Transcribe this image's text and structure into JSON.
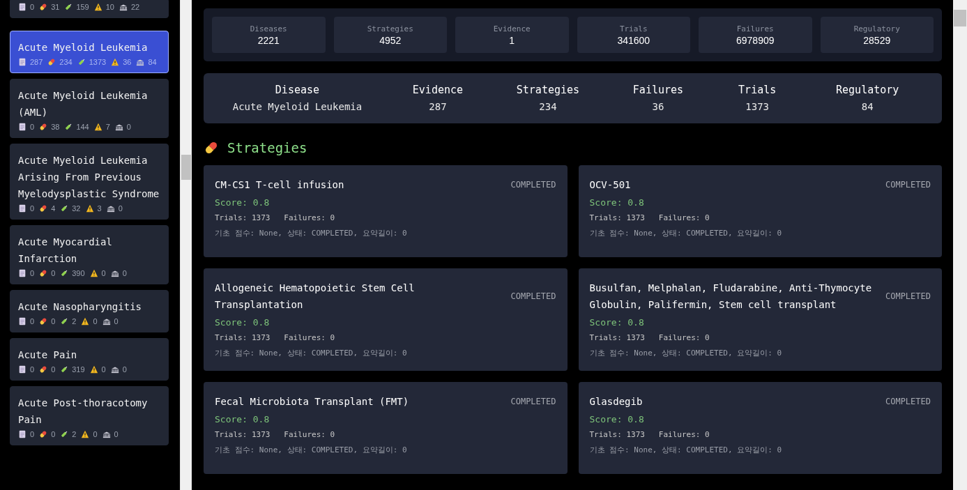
{
  "sidebar": {
    "items": [
      {
        "selected": false,
        "stats": [
          {
            "kind": "evidence",
            "value": "0"
          },
          {
            "kind": "strategy",
            "value": "31"
          },
          {
            "kind": "trial",
            "value": "159"
          },
          {
            "kind": "failure",
            "value": "10"
          },
          {
            "kind": "regulatory",
            "value": "22"
          }
        ]
      },
      {
        "name": "Acute Myeloid Leukemia",
        "selected": true,
        "stats": [
          {
            "kind": "evidence",
            "value": "287"
          },
          {
            "kind": "strategy",
            "value": "234"
          },
          {
            "kind": "trial",
            "value": "1373"
          },
          {
            "kind": "failure",
            "value": "36"
          },
          {
            "kind": "regulatory",
            "value": "84"
          }
        ]
      },
      {
        "name": "Acute Myeloid Leukemia (AML)",
        "selected": false,
        "stats": [
          {
            "kind": "evidence",
            "value": "0"
          },
          {
            "kind": "strategy",
            "value": "38"
          },
          {
            "kind": "trial",
            "value": "144"
          },
          {
            "kind": "failure",
            "value": "7"
          },
          {
            "kind": "regulatory",
            "value": "0"
          }
        ]
      },
      {
        "name": "Acute Myeloid Leukemia Arising From Previous Myelodysplastic Syndrome",
        "selected": false,
        "stats": [
          {
            "kind": "evidence",
            "value": "0"
          },
          {
            "kind": "strategy",
            "value": "4"
          },
          {
            "kind": "trial",
            "value": "32"
          },
          {
            "kind": "failure",
            "value": "3"
          },
          {
            "kind": "regulatory",
            "value": "0"
          }
        ]
      },
      {
        "name": "Acute Myocardial Infarction",
        "selected": false,
        "stats": [
          {
            "kind": "evidence",
            "value": "0"
          },
          {
            "kind": "strategy",
            "value": "0"
          },
          {
            "kind": "trial",
            "value": "390"
          },
          {
            "kind": "failure",
            "value": "0"
          },
          {
            "kind": "regulatory",
            "value": "0"
          }
        ]
      },
      {
        "name": "Acute Nasopharyngitis",
        "selected": false,
        "stats": [
          {
            "kind": "evidence",
            "value": "0"
          },
          {
            "kind": "strategy",
            "value": "0"
          },
          {
            "kind": "trial",
            "value": "2"
          },
          {
            "kind": "failure",
            "value": "0"
          },
          {
            "kind": "regulatory",
            "value": "0"
          }
        ]
      },
      {
        "name": "Acute Pain",
        "selected": false,
        "stats": [
          {
            "kind": "evidence",
            "value": "0"
          },
          {
            "kind": "strategy",
            "value": "0"
          },
          {
            "kind": "trial",
            "value": "319"
          },
          {
            "kind": "failure",
            "value": "0"
          },
          {
            "kind": "regulatory",
            "value": "0"
          }
        ]
      },
      {
        "name": "Acute Post-thoracotomy Pain",
        "selected": false,
        "stats": [
          {
            "kind": "evidence",
            "value": "0"
          },
          {
            "kind": "strategy",
            "value": "0"
          },
          {
            "kind": "trial",
            "value": "2"
          },
          {
            "kind": "failure",
            "value": "0"
          },
          {
            "kind": "regulatory",
            "value": "0"
          }
        ]
      }
    ]
  },
  "totals": [
    {
      "label": "Diseases",
      "value": "2221"
    },
    {
      "label": "Strategies",
      "value": "4952"
    },
    {
      "label": "Evidence",
      "value": "1"
    },
    {
      "label": "Trials",
      "value": "341600"
    },
    {
      "label": "Failures",
      "value": "6978909"
    },
    {
      "label": "Regulatory",
      "value": "28529"
    }
  ],
  "summary": [
    {
      "label": "Disease",
      "value": "Acute Myeloid Leukemia"
    },
    {
      "label": "Evidence",
      "value": "287"
    },
    {
      "label": "Strategies",
      "value": "234"
    },
    {
      "label": "Failures",
      "value": "36"
    },
    {
      "label": "Trials",
      "value": "1373"
    },
    {
      "label": "Regulatory",
      "value": "84"
    }
  ],
  "section_title": "Strategies",
  "strategies": [
    {
      "name": "CM-CS1 T-cell infusion",
      "status": "COMPLETED",
      "score": "Score: 0.8",
      "counts": "Trials: 1373   Failures: 0",
      "details": "기초 점수: None, 상태: COMPLETED, 요약길이: 0"
    },
    {
      "name": "OCV-501",
      "status": "COMPLETED",
      "score": "Score: 0.8",
      "counts": "Trials: 1373   Failures: 0",
      "details": "기초 점수: None, 상태: COMPLETED, 요약길이: 0"
    },
    {
      "name": "Allogeneic Hematopoietic Stem Cell Transplantation",
      "status": "COMPLETED",
      "score": "Score: 0.8",
      "counts": "Trials: 1373   Failures: 0",
      "details": "기초 점수: None, 상태: COMPLETED, 요약길이: 0"
    },
    {
      "name": "Busulfan, Melphalan, Fludarabine, Anti-Thymocyte Globulin, Palifermin, Stem cell transplant",
      "status": "COMPLETED",
      "score": "Score: 0.8",
      "counts": "Trials: 1373   Failures: 0",
      "details": "기초 점수: None, 상태: COMPLETED, 요약길이: 0"
    },
    {
      "name": "Fecal Microbiota Transplant (FMT)",
      "status": "COMPLETED",
      "score": "Score: 0.8",
      "counts": "Trials: 1373   Failures: 0",
      "details": "기초 점수: None, 상태: COMPLETED, 요약길이: 0"
    },
    {
      "name": "Glasdegib",
      "status": "COMPLETED",
      "score": "Score: 0.8",
      "counts": "Trials: 1373   Failures: 0",
      "details": "기초 점수: None, 상태: COMPLETED, 요약길이: 0"
    }
  ]
}
